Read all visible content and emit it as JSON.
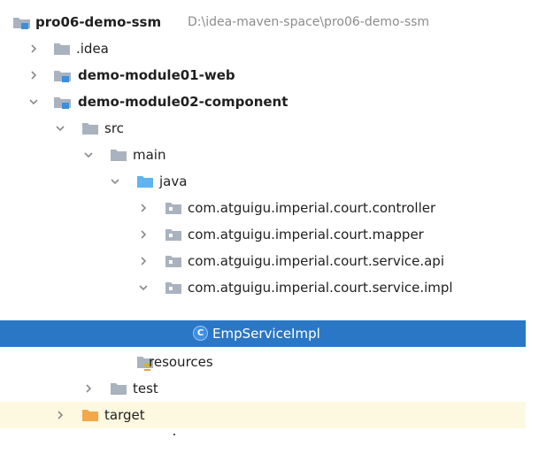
{
  "tree": {
    "root": {
      "name": "pro06-demo-ssm",
      "path": "D:\\idea-maven-space\\pro06-demo-ssm"
    },
    "nodes": [
      {
        "label": ".idea",
        "expanded": false,
        "icon": "folder-icon"
      },
      {
        "label": "demo-module01-web",
        "expanded": false,
        "icon": "module-folder-icon"
      },
      {
        "label": "demo-module02-component",
        "expanded": true,
        "icon": "module-folder-icon"
      },
      {
        "label": "src",
        "expanded": true,
        "icon": "folder-icon"
      },
      {
        "label": "main",
        "expanded": true,
        "icon": "folder-icon"
      },
      {
        "label": "java",
        "expanded": true,
        "icon": "source-folder-icon"
      },
      {
        "label": "com.atguigu.imperial.court.controller",
        "expanded": false,
        "icon": "package-icon"
      },
      {
        "label": "com.atguigu.imperial.court.mapper",
        "expanded": false,
        "icon": "package-icon"
      },
      {
        "label": "com.atguigu.imperial.court.service.api",
        "expanded": false,
        "icon": "package-icon"
      },
      {
        "label": "com.atguigu.imperial.court.service.impl",
        "expanded": true,
        "icon": "package-icon"
      },
      {
        "label": "EmpServiceImpl",
        "selected": true,
        "icon": "class-icon",
        "badge": "C"
      },
      {
        "label": "resources",
        "icon": "resources-folder-icon"
      },
      {
        "label": "test",
        "expanded": false,
        "icon": "folder-icon"
      },
      {
        "label": "target",
        "expanded": false,
        "icon": "excluded-folder-icon"
      }
    ]
  },
  "colors": {
    "selection": "#2a77c6",
    "folder": "#a9b3bf",
    "source_folder": "#5eb5ef",
    "excluded_folder": "#f3a84b",
    "module_marker": "#3c8fd8",
    "excluded_row": "#fdf8e0"
  }
}
